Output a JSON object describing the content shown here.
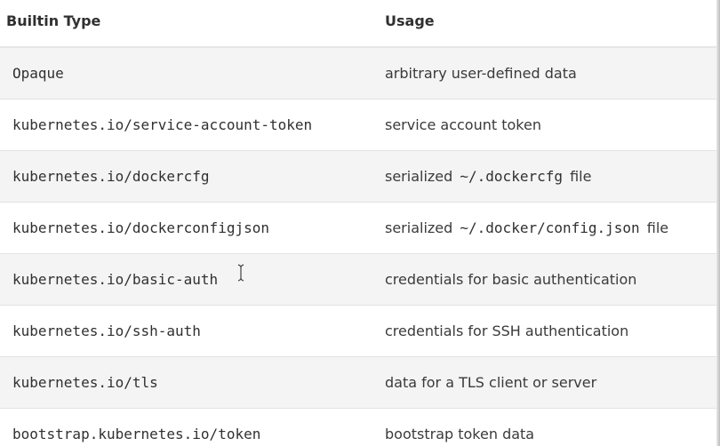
{
  "table": {
    "headers": [
      "Builtin Type",
      "Usage"
    ],
    "rows": [
      {
        "type": "Opaque",
        "usage": [
          {
            "t": "arbitrary user-defined data"
          }
        ]
      },
      {
        "type": "kubernetes.io/service-account-token",
        "usage": [
          {
            "t": "service account token"
          }
        ]
      },
      {
        "type": "kubernetes.io/dockercfg",
        "usage": [
          {
            "t": "serialized"
          },
          {
            "t": "~/.dockercfg",
            "code": true
          },
          {
            "t": "file"
          }
        ]
      },
      {
        "type": "kubernetes.io/dockerconfigjson",
        "usage": [
          {
            "t": "serialized"
          },
          {
            "t": "~/.docker/config.json",
            "code": true
          },
          {
            "t": "file"
          }
        ]
      },
      {
        "type": "kubernetes.io/basic-auth",
        "usage": [
          {
            "t": "credentials for basic authentication"
          }
        ]
      },
      {
        "type": "kubernetes.io/ssh-auth",
        "usage": [
          {
            "t": "credentials for SSH authentication"
          }
        ]
      },
      {
        "type": "kubernetes.io/tls",
        "usage": [
          {
            "t": "data for a TLS client or server"
          }
        ]
      },
      {
        "type": "bootstrap.kubernetes.io/token",
        "usage": [
          {
            "t": "bootstrap token data"
          }
        ]
      }
    ]
  },
  "colors": {
    "row_stripe": "#f4f4f4",
    "text": "#303030",
    "border": "#e2e2e2"
  },
  "icons": {
    "cursor": "text-cursor-icon"
  }
}
